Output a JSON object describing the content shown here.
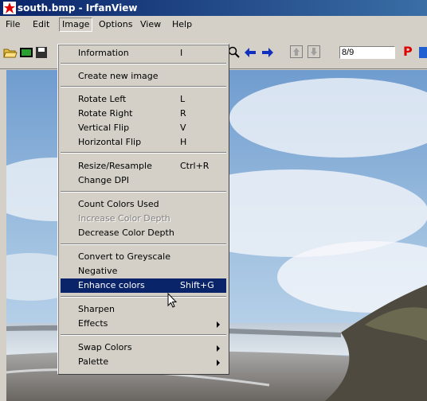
{
  "window": {
    "title": "south.bmp - IrfanView"
  },
  "menubar": {
    "file": "File",
    "edit": "Edit",
    "image": "Image",
    "options": "Options",
    "view": "View",
    "help": "Help"
  },
  "toolbar": {
    "page_field": "8/9",
    "p_button": "P"
  },
  "image_menu": {
    "information": {
      "label": "Information",
      "shortcut": "I"
    },
    "create_new_image": {
      "label": "Create new image"
    },
    "rotate_left": {
      "label": "Rotate Left",
      "shortcut": "L"
    },
    "rotate_right": {
      "label": "Rotate Right",
      "shortcut": "R"
    },
    "vertical_flip": {
      "label": "Vertical Flip",
      "shortcut": "V"
    },
    "horizontal_flip": {
      "label": "Horizontal Flip",
      "shortcut": "H"
    },
    "resize_resample": {
      "label": "Resize/Resample",
      "shortcut": "Ctrl+R"
    },
    "change_dpi": {
      "label": "Change DPI"
    },
    "count_colors": {
      "label": "Count Colors Used"
    },
    "increase_color_depth": {
      "label": "Increase Color Depth"
    },
    "decrease_color_depth": {
      "label": "Decrease Color Depth"
    },
    "convert_greyscale": {
      "label": "Convert to Greyscale"
    },
    "negative": {
      "label": "Negative"
    },
    "enhance_colors": {
      "label": "Enhance colors",
      "shortcut": "Shift+G"
    },
    "sharpen": {
      "label": "Sharpen"
    },
    "effects": {
      "label": "Effects"
    },
    "swap_colors": {
      "label": "Swap Colors"
    },
    "palette": {
      "label": "Palette"
    }
  },
  "colors": {
    "highlight": "#0a246a",
    "titlebar": "#0a246a",
    "face": "#d4d0c8"
  }
}
